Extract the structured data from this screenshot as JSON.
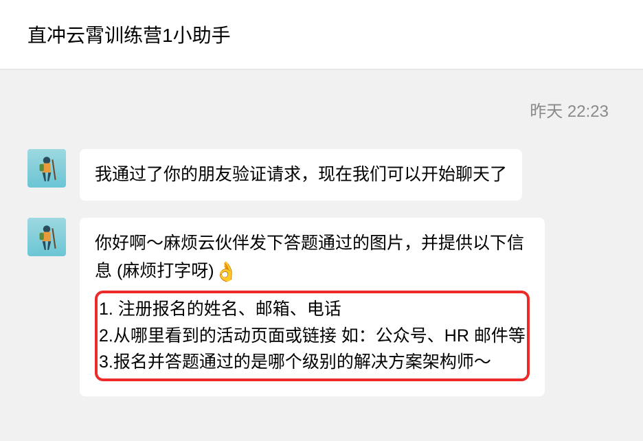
{
  "header": {
    "title": "直冲云霄训练营1小助手"
  },
  "chat": {
    "timestamp": "昨天 22:23",
    "messages": [
      {
        "text": "我通过了你的朋友验证请求，现在我们可以开始聊天了"
      },
      {
        "intro_line1": "你好啊～麻烦云伙伴发下答题通过的图片，并提供以下信",
        "intro_line2_pre": "息 (麻烦打字呀)",
        "emoji": "👌",
        "list": {
          "item1": "1. 注册报名的姓名、邮箱、电话",
          "item2": "2.从哪里看到的活动页面或链接  如：公众号、HR 邮件等",
          "item3": "3.报名并答题通过的是哪个级别的解决方案架构师～"
        }
      }
    ]
  }
}
